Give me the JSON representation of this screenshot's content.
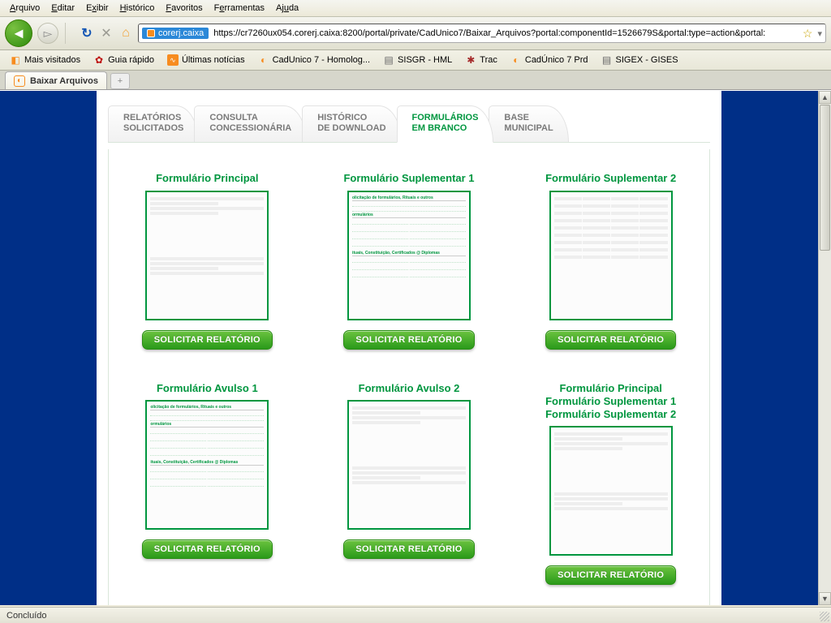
{
  "menu": {
    "arquivo": "Arquivo",
    "editar": "Editar",
    "exibir": "Exibir",
    "historico": "Histórico",
    "favoritos": "Favoritos",
    "ferramentas": "Ferramentas",
    "ajuda": "Ajuda"
  },
  "url": {
    "host": "corerj.caixa",
    "full": "https://cr7260ux054.corerj.caixa:8200/portal/private/CadUnico7/Baixar_Arquivos?portal:componentId=1526679S&portal:type=action&portal:"
  },
  "bookmarks": {
    "mais": "Mais visitados",
    "guia": "Guia rápido",
    "ultimas": "Últimas notícias",
    "cad7h": "CadUnico 7 - Homolog...",
    "sisgr": "SISGR - HML",
    "trac": "Trac",
    "cad7p": "CadÚnico 7 Prd",
    "sigex": "SIGEX - GISES"
  },
  "tab": {
    "title": "Baixar Arquivos"
  },
  "ctabs": {
    "rel1": "RELATÓRIOS",
    "rel2": "SOLICITADOS",
    "con1": "CONSULTA",
    "con2": "CONCESSIONÁRIA",
    "his1": "HISTÓRICO",
    "his2": "DE DOWNLOAD",
    "for1": "FORMULÁRIOS",
    "for2": "EM BRANCO",
    "bas1": "BASE",
    "bas2": "MUNICIPAL"
  },
  "cards": {
    "btn": "SOLICITAR RELATÓRIO",
    "c1": "Formulário Principal",
    "c2": "Formulário Suplementar 1",
    "c3": "Formulário Suplementar 2",
    "c4": "Formulário Avulso 1",
    "c5": "Formulário Avulso 2",
    "c6a": "Formulário Principal",
    "c6b": "Formulário Suplementar 1",
    "c6c": "Formulário Suplementar 2"
  },
  "status": "Concluído"
}
